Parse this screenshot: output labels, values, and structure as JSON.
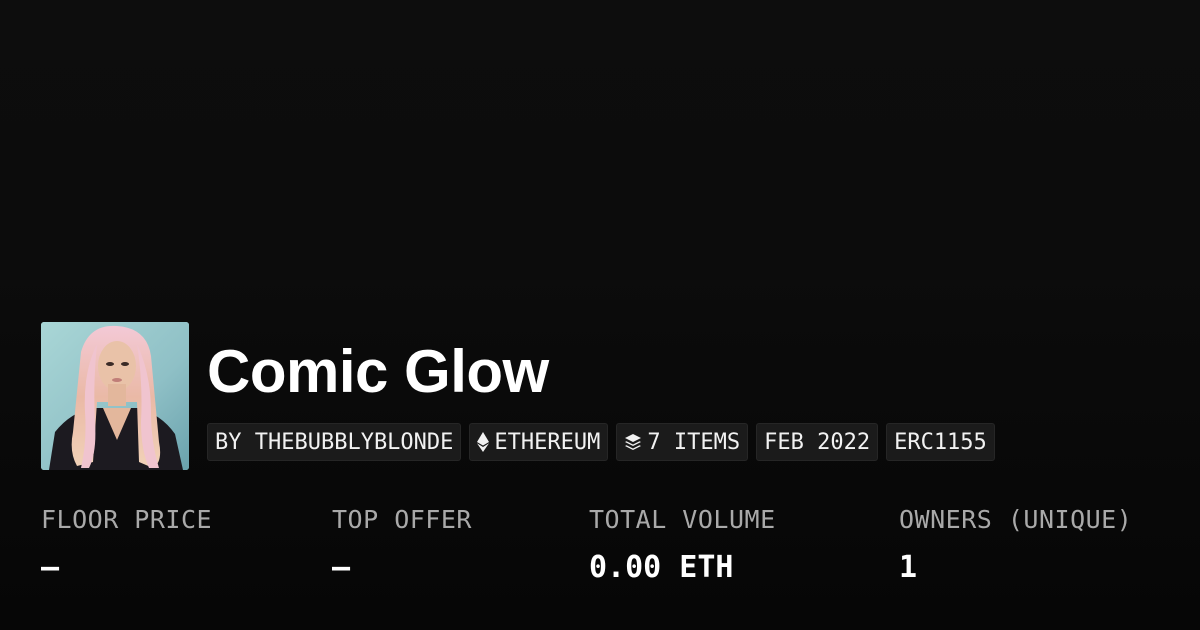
{
  "collection": {
    "title": "Comic Glow",
    "avatar_alt": "collection-avatar"
  },
  "tags": {
    "creator": "BY THEBUBBLYBLONDE",
    "chain": "ETHEREUM",
    "chain_icon": "ethereum-icon",
    "items": "7 ITEMS",
    "items_icon": "layers-icon",
    "date": "FEB 2022",
    "standard": "ERC1155"
  },
  "stats": {
    "floor_price": {
      "label": "FLOOR PRICE",
      "value": "—"
    },
    "top_offer": {
      "label": "TOP OFFER",
      "value": "—"
    },
    "total_volume": {
      "label": "TOTAL VOLUME",
      "value": "0.00 ETH"
    },
    "owners": {
      "label": "OWNERS (UNIQUE)",
      "value": "1"
    }
  },
  "colors": {
    "background": "#0a0a0a",
    "tag_background": "#1b1b1b",
    "label_gray": "#a9a9a9",
    "text_white": "#ffffff"
  }
}
